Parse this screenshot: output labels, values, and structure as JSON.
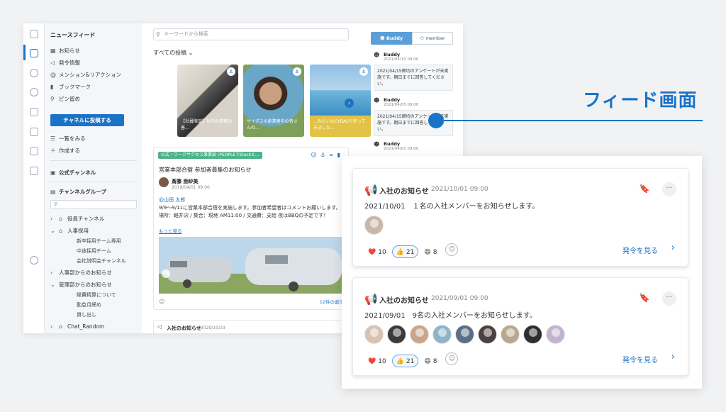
{
  "sidebar": {
    "section_title": "ニュースフィード",
    "items": [
      {
        "label": "お知らせ",
        "icon": "▦"
      },
      {
        "label": "発令情報",
        "icon": "◁"
      },
      {
        "label": "メンション&リアクション",
        "icon": "@"
      },
      {
        "label": "ブックマーク",
        "icon": "▮"
      },
      {
        "label": "ピン留め",
        "icon": "⚲"
      }
    ],
    "post_button": "チャネルに投稿する",
    "list_all": "一覧をみる",
    "create": "作成する",
    "official_channel": "公式チャンネル",
    "channel_group": "チャンネルグループ",
    "groups": [
      {
        "label": "役員チャンネル",
        "expanded": false
      },
      {
        "label": "人事採用",
        "expanded": true,
        "children": [
          "新卒採用チーム専用",
          "中途採用チーム",
          "会社説明会チャンネル"
        ]
      },
      {
        "label": "人事部からのお知らせ",
        "expanded": false
      },
      {
        "label": "管理部からのお知らせ",
        "expanded": true,
        "children": [
          "経費精算について",
          "勤怠月締め",
          "貸し出し"
        ]
      },
      {
        "label": "Chat_Random",
        "expanded": false
      }
    ]
  },
  "feed": {
    "search_placeholder": "キーワードから検索",
    "filter_label": "すべての投稿",
    "thumbnails": [
      {
        "caption": "【社員限定】社内の業務改善..."
      },
      {
        "caption": "サイダスの創業者中の皆さんの..."
      },
      {
        "caption": "...みたいなCYDASで作ってみました..."
      }
    ],
    "post": {
      "tag": "公式・ワークサクセス事業部 (PEOPLEでSlackと...",
      "title": "営業本部合宿 参加者募集のお知らせ",
      "author": "斎藤 亜紗美",
      "date": "2019/04/01 09:00",
      "mention": "@山田 太郎",
      "body_line1": "9/9〜9/11に営業本部合宿を実施します。参加者希望者はコメントお願いします。",
      "body_line2": "場所：軽井沢 / 集合：現地 AM11:00 / 交通費：支給 夜はBBQの予定です！",
      "more": "もっと見る",
      "comments": "12件の返信"
    },
    "post2": {
      "title": "入社のお知らせ",
      "date": "2020/10/23"
    }
  },
  "buddy_panel": {
    "tab_buddy": "Buddy",
    "tab_member": "member",
    "messages": [
      {
        "name": "Buddy",
        "date": "2021/04/10 09:00",
        "text": "2021/04/15締切のアンケートが未実施です。期日までに回答してください。"
      },
      {
        "name": "Buddy",
        "date": "2021/04/05 09:00",
        "text": "2021/04/15締切のアンケートが未実施です。期日までに回答してください。"
      },
      {
        "name": "Buddy",
        "date": "2021/04/01 09:00",
        "text": ""
      }
    ]
  },
  "callout": {
    "title": "フィード画面"
  },
  "cards": [
    {
      "title": "入社のお知らせ",
      "date": "2021/10/01 09:00",
      "text": "2021/10/01　１名の入社メンバーをお知らせします。",
      "face_colors": [
        "#c9b7a6"
      ],
      "reactions": [
        {
          "emoji": "❤️",
          "count": "10",
          "on": false
        },
        {
          "emoji": "👍",
          "count": "21",
          "on": true
        },
        {
          "emoji": "😄",
          "count": "8",
          "on": false
        }
      ],
      "see_order": "発令を見る"
    },
    {
      "title": "入社のお知らせ",
      "date": "2021/09/01 09:00",
      "text": "2021/09/01　9名の入社メンバーをお知らせします。",
      "face_colors": [
        "#d9c2b0",
        "#3a3a3a",
        "#caa58a",
        "#8fb4c9",
        "#5a6f86",
        "#4d4040",
        "#b9a78f",
        "#2f2f33",
        "#c4b3d0"
      ],
      "reactions": [
        {
          "emoji": "❤️",
          "count": "10",
          "on": false
        },
        {
          "emoji": "👍",
          "count": "21",
          "on": true
        },
        {
          "emoji": "😄",
          "count": "8",
          "on": false
        }
      ],
      "see_order": "発令を見る"
    }
  ],
  "colors": {
    "accent": "#1a73c7",
    "tag": "#4fb38a",
    "buddy_tab": "#5b9fd8"
  }
}
